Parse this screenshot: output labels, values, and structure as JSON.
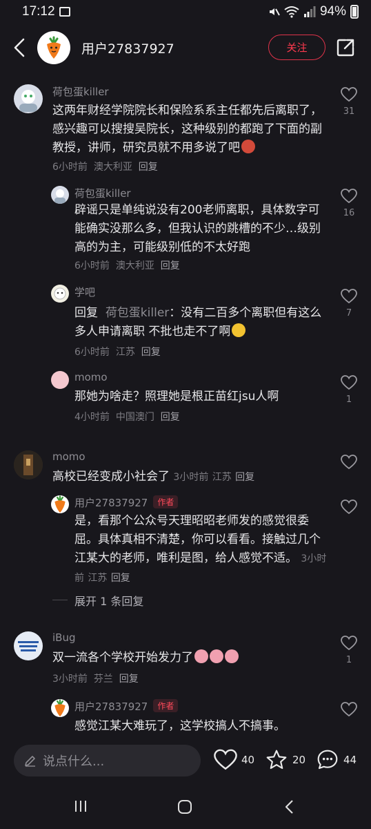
{
  "status_bar": {
    "time": "17:12",
    "battery": "94%"
  },
  "header": {
    "username": "用户27837927",
    "follow_label": "关注"
  },
  "comments": [
    {
      "user": "荷包蛋killer",
      "text": "这两年财经学院院长和保险系系主任都先后离职了，感兴趣可以搜搜吴院长，这种级别的都跑了下面的副教授，讲师，研究员就不用多说了吧",
      "time": "6小时前",
      "location": "澳大利亚",
      "reply_label": "回复",
      "likes": "31",
      "replies": [
        {
          "user": "荷包蛋killer",
          "text": "辟谣只是单纯说没有200老师离职，具体数字可能确实没那么多，但我认识的跳槽的不少…级别高的为主，可能级别低的不太好跑",
          "time": "6小时前",
          "location": "澳大利亚",
          "reply_label": "回复",
          "likes": "16"
        },
        {
          "user": "学吧",
          "reply_prefix": "回复",
          "reply_to": "荷包蛋killer",
          "text": "：没有二百多个离职但有这么多人申请离职 不批也走不了啊",
          "time": "6小时前",
          "location": "江苏",
          "reply_label": "回复",
          "likes": "7"
        },
        {
          "user": "momo",
          "text": "那她为啥走？照理她是根正苗红jsu人啊",
          "time": "4小时前",
          "location": "中国澳门",
          "reply_label": "回复",
          "likes": "1"
        }
      ]
    },
    {
      "user": "momo",
      "text": "高校已经变成小社会了",
      "time": "3小时前",
      "location": "江苏",
      "reply_label": "回复",
      "likes": "",
      "replies": [
        {
          "user": "用户27837927",
          "tag": "作者",
          "text": "是，看那个公众号天理昭昭老师发的感觉很委屈。具体真相不清楚，你可以看看。接触过几个江某大的老师，唯利是图，给人感觉不适。",
          "time": "3小时前",
          "location": "江苏",
          "reply_label": "回复",
          "likes": ""
        }
      ],
      "expand_label": "展开 1 条回复"
    },
    {
      "user": "iBug",
      "text": "双一流各个学校开始发力了",
      "time": "3小时前",
      "location": "芬兰",
      "reply_label": "回复",
      "likes": "1",
      "replies": [
        {
          "user": "用户27837927",
          "tag": "作者",
          "text": "感觉江某大难玩了，这学校搞人不搞事。",
          "likes": ""
        }
      ]
    }
  ],
  "bottom_bar": {
    "input_placeholder": "说点什么...",
    "like_count": "40",
    "star_count": "20",
    "comment_count": "44"
  },
  "colors": {
    "background": "#18171c",
    "accent": "#ff3a4e",
    "text": "#e6e6e8",
    "muted": "#8e8d93"
  }
}
